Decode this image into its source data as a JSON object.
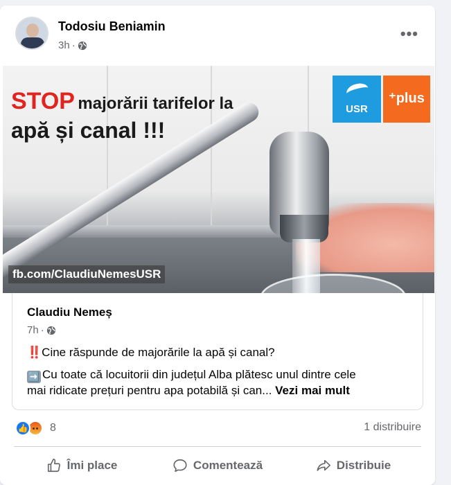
{
  "post": {
    "author": "Todosiu Beniamin",
    "time": "3h",
    "separator": "·",
    "more_icon": "more-horizontal-icon",
    "privacy_icon": "globe-icon"
  },
  "image": {
    "headline_stop": "STOP",
    "headline_rest": "majorării tarifelor la",
    "headline_line2": "apă și canal !!!",
    "logo_usr": "USR",
    "logo_plus": "⁺plus",
    "watermark": "fb.com/ClaudiuNemesUSR"
  },
  "shared_post": {
    "author": "Claudiu Nemeș",
    "time": "7h",
    "separator": "·",
    "line1": "Cine răspunde de majorările la apă și canal?",
    "line2": "Cu toate că locuitorii din județul Alba plătesc unul dintre cele",
    "line3": "mai ridicate prețuri pentru apa potabilă și can...",
    "see_more": "Vezi mai mult",
    "line1_emoji": "‼️",
    "line2_emoji": "➡️"
  },
  "stats": {
    "reaction_count": "8",
    "shares": "1 distribuire",
    "reaction_icons": [
      "like-icon",
      "angry-icon"
    ]
  },
  "actions": {
    "like": "Îmi place",
    "comment": "Comentează",
    "share": "Distribuie"
  },
  "colors": {
    "facebook_blue": "#1877f2",
    "headline_red": "#e0241f",
    "usr_blue": "#1f9be0",
    "plus_orange": "#f46a1f"
  }
}
